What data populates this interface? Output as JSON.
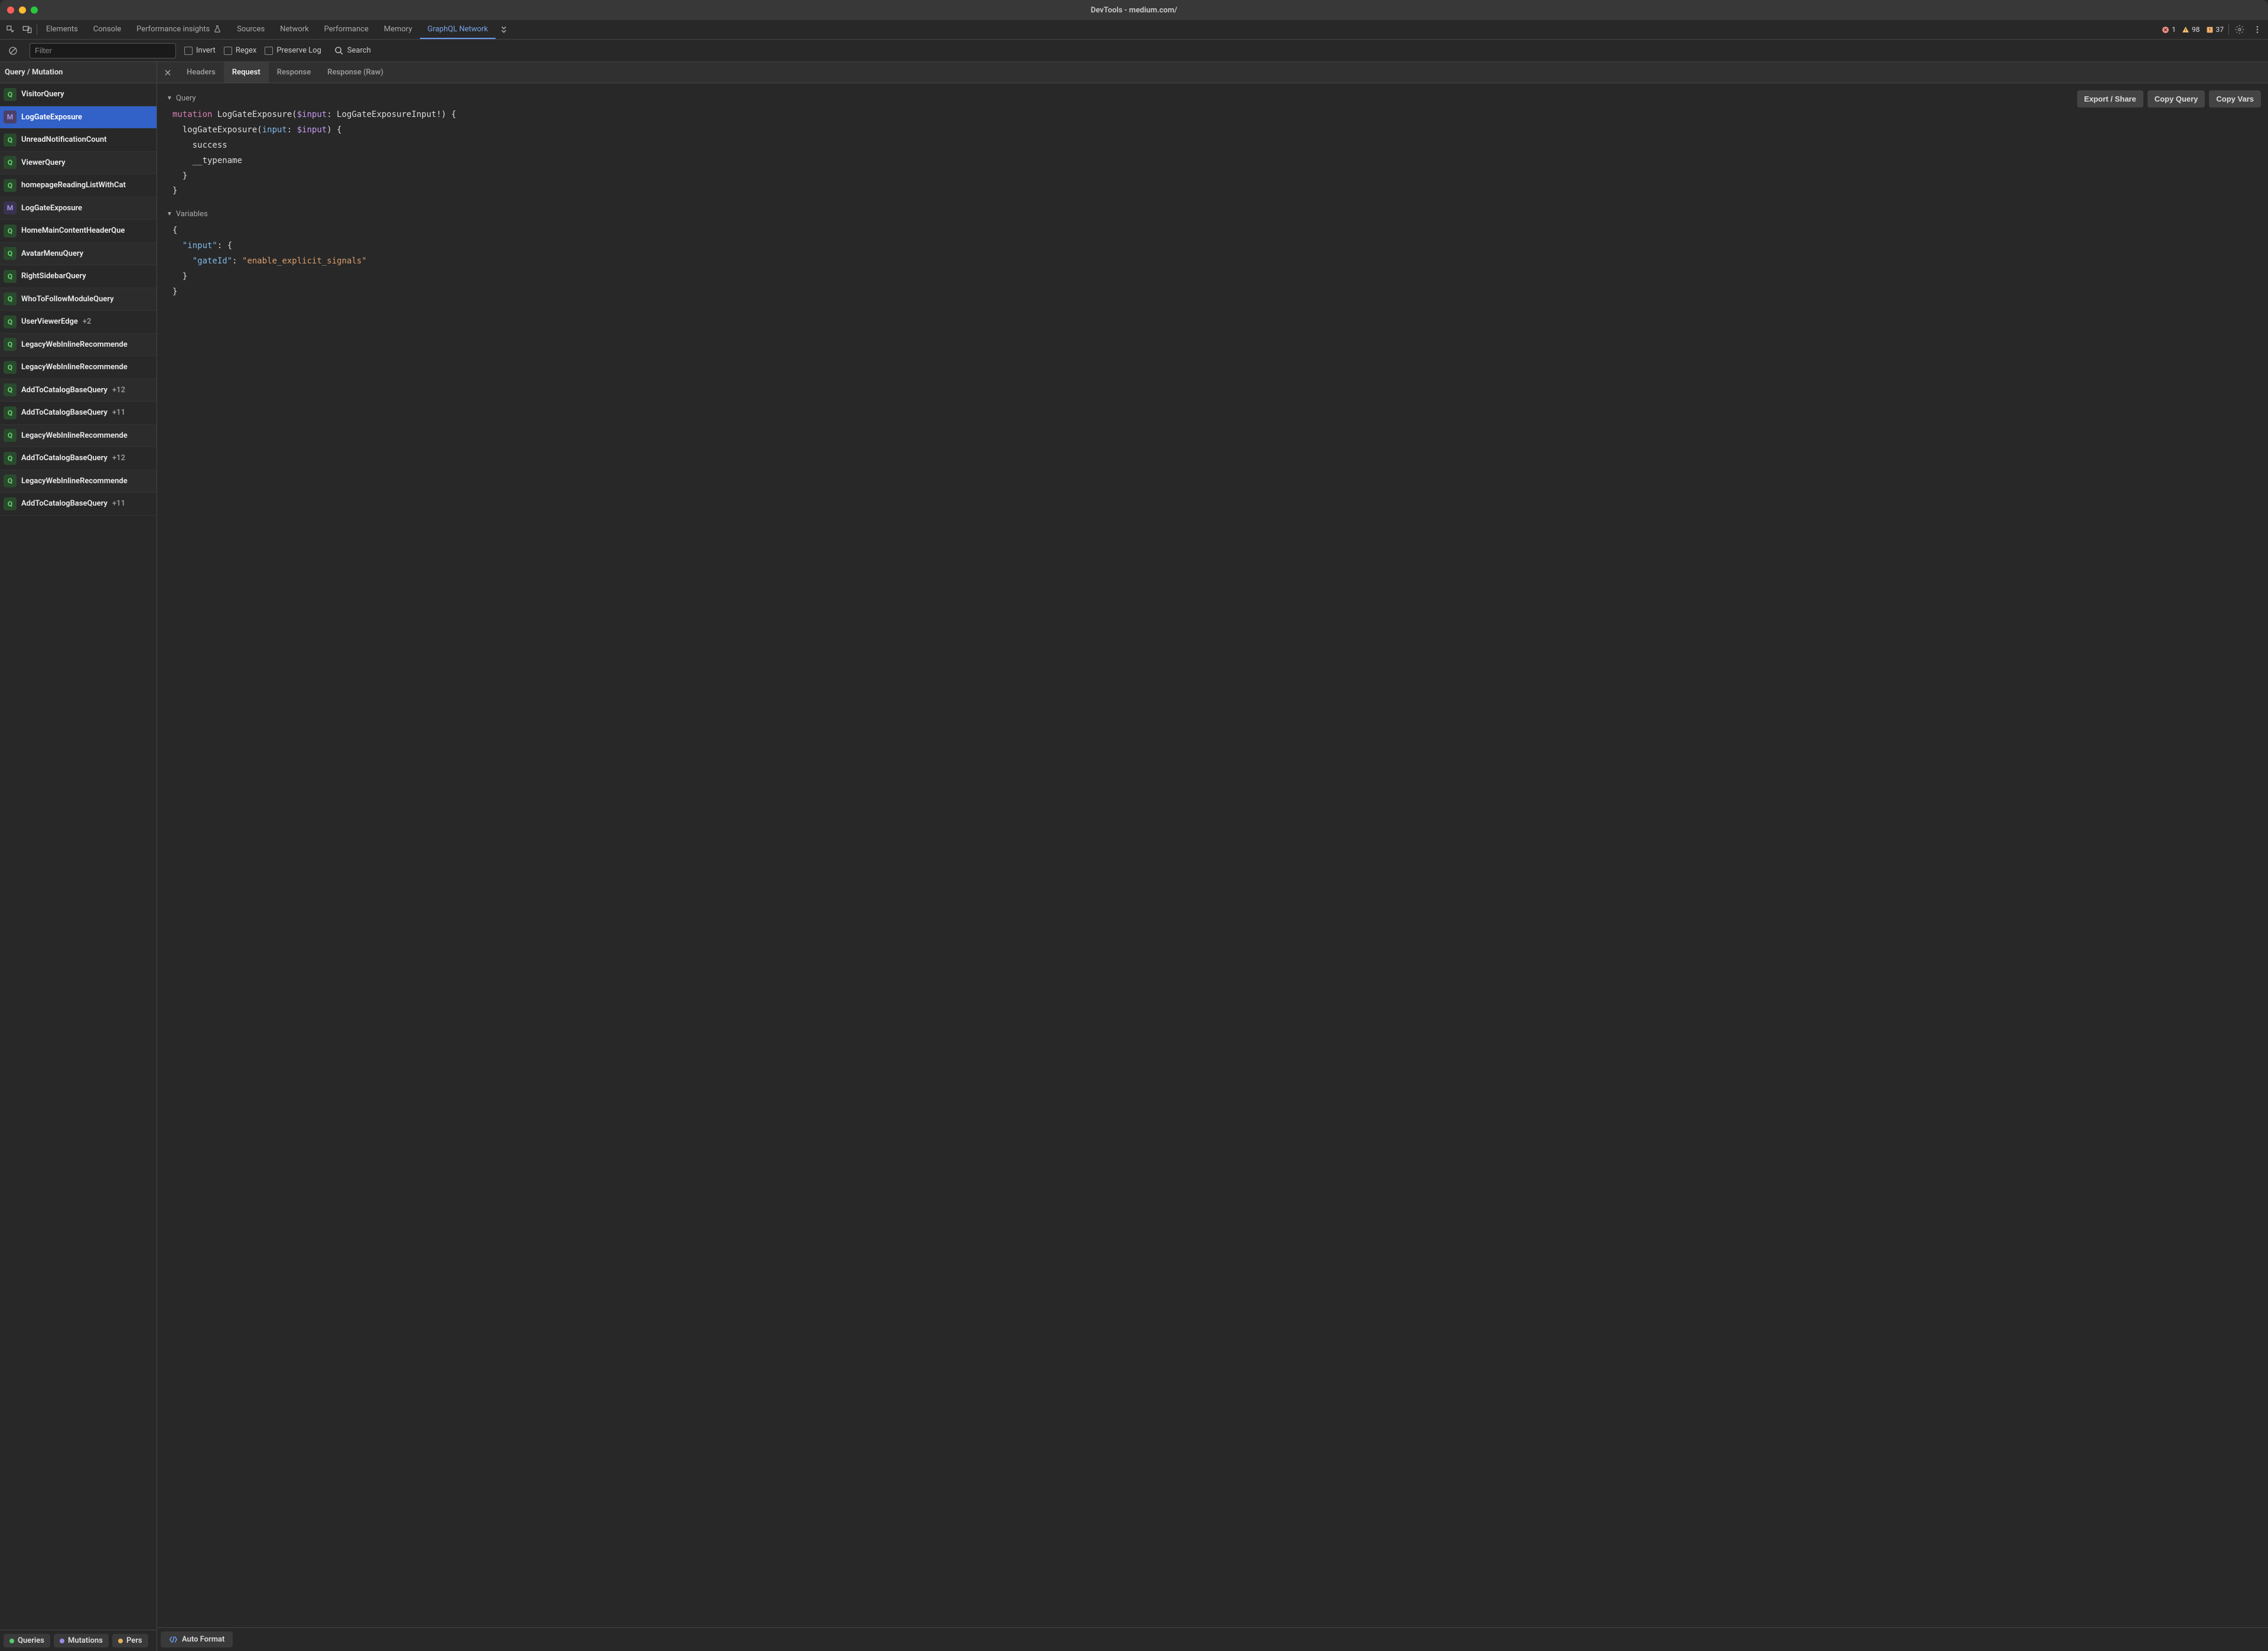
{
  "window_title": "DevTools - medium.com/",
  "main_tabs": {
    "elements": "Elements",
    "console": "Console",
    "perf_insights": "Performance insights",
    "sources": "Sources",
    "network": "Network",
    "performance": "Performance",
    "memory": "Memory",
    "graphql_network": "GraphQL Network"
  },
  "status": {
    "errors": "1",
    "warnings": "98",
    "issues": "37"
  },
  "toolbar": {
    "filter_placeholder": "Filter",
    "invert": "Invert",
    "regex": "Regex",
    "preserve_log": "Preserve Log",
    "search": "Search"
  },
  "sidebar": {
    "header": "Query / Mutation",
    "items": [
      {
        "type": "Q",
        "name": "VisitorQuery",
        "extra": ""
      },
      {
        "type": "M",
        "name": "LogGateExposure",
        "extra": "",
        "selected": true
      },
      {
        "type": "Q",
        "name": "UnreadNotificationCount",
        "extra": ""
      },
      {
        "type": "Q",
        "name": "ViewerQuery",
        "extra": ""
      },
      {
        "type": "Q",
        "name": "homepageReadingListWithCat",
        "extra": ""
      },
      {
        "type": "M",
        "name": "LogGateExposure",
        "extra": ""
      },
      {
        "type": "Q",
        "name": "HomeMainContentHeaderQue",
        "extra": ""
      },
      {
        "type": "Q",
        "name": "AvatarMenuQuery",
        "extra": ""
      },
      {
        "type": "Q",
        "name": "RightSidebarQuery",
        "extra": ""
      },
      {
        "type": "Q",
        "name": "WhoToFollowModuleQuery",
        "extra": ""
      },
      {
        "type": "Q",
        "name": "UserViewerEdge",
        "extra": "+2"
      },
      {
        "type": "Q",
        "name": "LegacyWebInlineRecommende",
        "extra": ""
      },
      {
        "type": "Q",
        "name": "LegacyWebInlineRecommende",
        "extra": ""
      },
      {
        "type": "Q",
        "name": "AddToCatalogBaseQuery",
        "extra": "+12"
      },
      {
        "type": "Q",
        "name": "AddToCatalogBaseQuery",
        "extra": "+11"
      },
      {
        "type": "Q",
        "name": "LegacyWebInlineRecommende",
        "extra": ""
      },
      {
        "type": "Q",
        "name": "AddToCatalogBaseQuery",
        "extra": "+12"
      },
      {
        "type": "Q",
        "name": "LegacyWebInlineRecommende",
        "extra": ""
      },
      {
        "type": "Q",
        "name": "AddToCatalogBaseQuery",
        "extra": "+11"
      }
    ],
    "chips": {
      "queries": "Queries",
      "mutations": "Mutations",
      "persisted": "Pers"
    }
  },
  "detail_tabs": {
    "headers": "Headers",
    "request": "Request",
    "response": "Response",
    "response_raw": "Response (Raw)"
  },
  "sections": {
    "query": "Query",
    "variables": "Variables"
  },
  "actions": {
    "export": "Export / Share",
    "copy_query": "Copy Query",
    "copy_vars": "Copy Vars"
  },
  "code": {
    "l1a": "mutation",
    "l1b": " LogGateExposure(",
    "l1c": "$input",
    "l1d": ": LogGateExposureInput!) {",
    "l2a": "  logGateExposure(",
    "l2b": "input",
    "l2c": ": ",
    "l2d": "$input",
    "l2e": ") {",
    "l3": "    success",
    "l4": "    __typename",
    "l5": "  }",
    "l6": "}"
  },
  "vars": {
    "l1": "{",
    "l2a": "  ",
    "l2b": "\"input\"",
    "l2c": ": {",
    "l3a": "    ",
    "l3b": "\"gateId\"",
    "l3c": ": ",
    "l3d": "\"enable_explicit_signals\"",
    "l4": "  }",
    "l5": "}"
  },
  "format_btn": "Auto Format"
}
